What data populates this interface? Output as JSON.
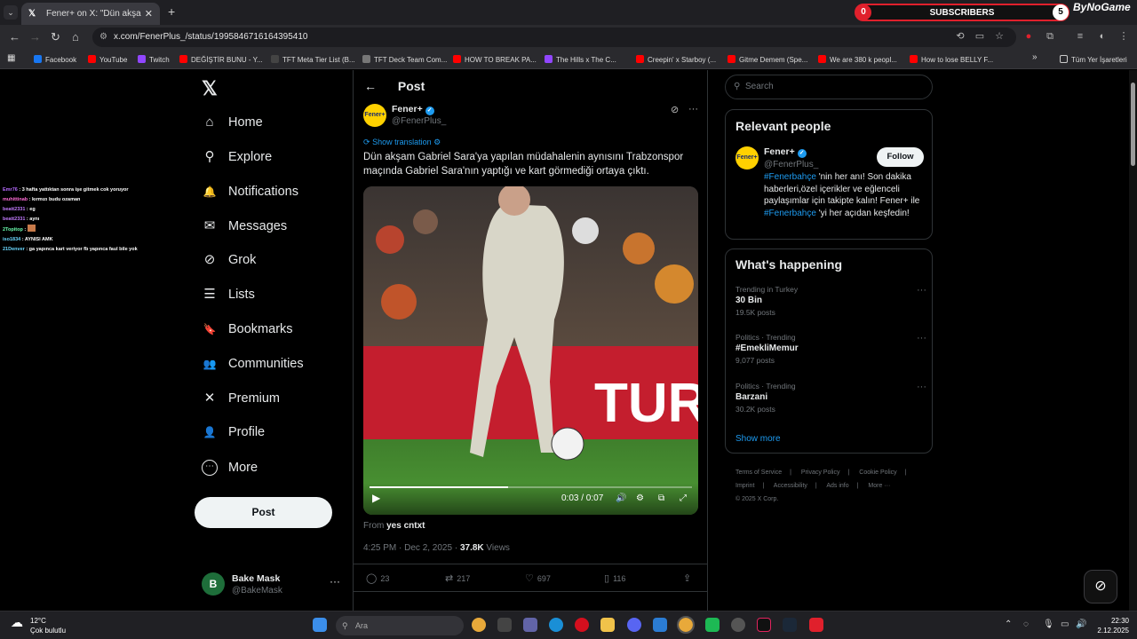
{
  "browser": {
    "tab_title": "Fener+ on X: \"Dün akşam Gabr",
    "url": "x.com/FenerPlus_/status/1995846716164395410",
    "subscribers_label": "SUBSCRIBERS",
    "subscribers_left": "0",
    "subscribers_right": "5",
    "brand": "ByNoGame",
    "bookmarks": [
      "Facebook",
      "YouTube",
      "Twitch",
      "DEĞİŞTİR BUNU - Y...",
      "TFT Meta Tier List (B...",
      "TFT Deck Team Com...",
      "HOW TO BREAK PA...",
      "The Hills x The C...",
      "Creepin' x Starboy (...",
      "Gitme Demem (Spe...",
      "We are 380 k peopl...",
      "How to lose BELLY F..."
    ],
    "bookmarks_more": "»",
    "all_bookmarks": "Tüm Yer İşaretleri"
  },
  "chat": [
    {
      "user": "Emr76",
      "text": ": 3 hafta yattıktan sonra işe gitmek cok yoruyor"
    },
    {
      "user": "muhittinab",
      "text": ": kırmızı budu ozaman"
    },
    {
      "user": "beatt2331",
      "text": ": eg"
    },
    {
      "user": "beatt2331",
      "text": ": aynı"
    },
    {
      "user": "2Topitop",
      "text": ":"
    },
    {
      "user": "iso1834",
      "text": ": AYNISI AMK"
    },
    {
      "user": "21Denver",
      "text": ": ga yapınca kart veriyor fb yapınca faul bile yok"
    }
  ],
  "nav": {
    "items": [
      {
        "label": "Home",
        "icon": "home-icon",
        "glyph": "⌂"
      },
      {
        "label": "Explore",
        "icon": "search-icon",
        "glyph": "⚲"
      },
      {
        "label": "Notifications",
        "icon": "bell-icon",
        "glyph": "🔔"
      },
      {
        "label": "Messages",
        "icon": "mail-icon",
        "glyph": "✉"
      },
      {
        "label": "Grok",
        "icon": "grok-icon",
        "glyph": "⊘"
      },
      {
        "label": "Lists",
        "icon": "list-icon",
        "glyph": "☰"
      },
      {
        "label": "Bookmarks",
        "icon": "bookmark-icon",
        "glyph": "🔖"
      },
      {
        "label": "Communities",
        "icon": "communities-icon",
        "glyph": "👥"
      },
      {
        "label": "Premium",
        "icon": "x-icon",
        "glyph": "✕"
      },
      {
        "label": "Profile",
        "icon": "person-icon",
        "glyph": "👤"
      },
      {
        "label": "More",
        "icon": "more-icon",
        "glyph": "⋯"
      }
    ],
    "post_button": "Post",
    "account_name": "Bake Mask",
    "account_handle": "@BakeMask",
    "account_initial": "B"
  },
  "post": {
    "header_title": "Post",
    "author_name": "Fener+",
    "author_handle": "@FenerPlus_",
    "avatar_text": "Fener+",
    "show_translation": "Show translation",
    "text": "Dün akşam Gabriel Sara'ya yapılan müdahalenin aynısını Trabzonspor maçında Gabriel Sara'nın yaptığı ve kart görmediği ortaya çıktı.",
    "video_time": "0:03 / 0:07",
    "video_progress": 0.43,
    "from_label": "From",
    "from_source": "yes cntxt",
    "time": "4:25 PM · Dec 2, 2025 · ",
    "views_count": "37.8K",
    "views_label": " Views",
    "replies": "23",
    "reposts": "217",
    "likes": "697",
    "bookmarks": "116"
  },
  "right": {
    "search_placeholder": "Search",
    "relevant_title": "Relevant people",
    "person_name": "Fener+",
    "person_handle": "@FenerPlus_",
    "follow_label": "Follow",
    "bio_tag1": "#Fenerbahçe",
    "bio_part1": " 'nin her anı! Son dakika haberleri,özel içerikler ve eğlenceli paylaşımlar için takipte kalın! Fener+ ile ",
    "bio_tag2": "#Fenerbahçe",
    "bio_part2": " 'yi her açıdan keşfedin!",
    "happening_title": "What's happening",
    "trends": [
      {
        "context": "Trending in Turkey",
        "name": "30 Bin",
        "posts": "19.5K posts"
      },
      {
        "context": "Politics · Trending",
        "name": "#EmekliMemur",
        "posts": "9,077 posts"
      },
      {
        "context": "Politics · Trending",
        "name": "Barzani",
        "posts": "30.2K posts"
      }
    ],
    "show_more": "Show more",
    "footer": [
      "Terms of Service",
      "|",
      "Privacy Policy",
      "|",
      "Cookie Policy",
      "|",
      "Imprint",
      "|",
      "Accessibility",
      "|",
      "Ads info",
      "|",
      "More ···",
      "© 2025 X Corp."
    ]
  },
  "taskbar": {
    "temp": "12°C",
    "weather": "Çok bulutlu",
    "search_placeholder": "Ara",
    "time": "22:30",
    "date": "2.12.2025"
  },
  "colors": {
    "accent": "#1d9bf0",
    "fener_yellow": "#ffd100",
    "sub_red": "#e0202c"
  }
}
